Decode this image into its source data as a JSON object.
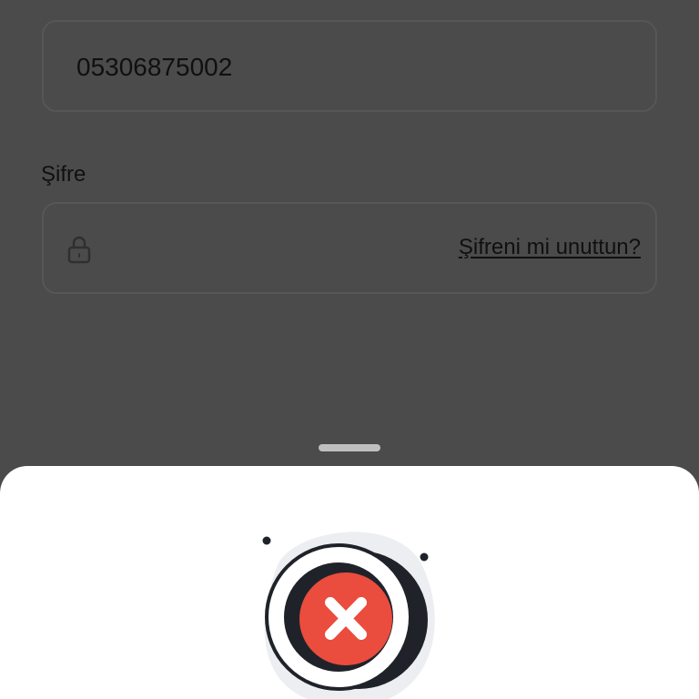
{
  "login": {
    "phone_value": "05306875002",
    "password_label": "Şifre",
    "forgot_password": "Şifreni mi unuttun?",
    "lock_icon": "lock-icon"
  },
  "bottom_sheet": {
    "status_icon": "error-x-icon"
  },
  "colors": {
    "overlay_background": "#4b4b4b",
    "sheet_background": "#ffffff",
    "error_red": "#ea4c3d",
    "dark_outline": "#1f2329"
  }
}
